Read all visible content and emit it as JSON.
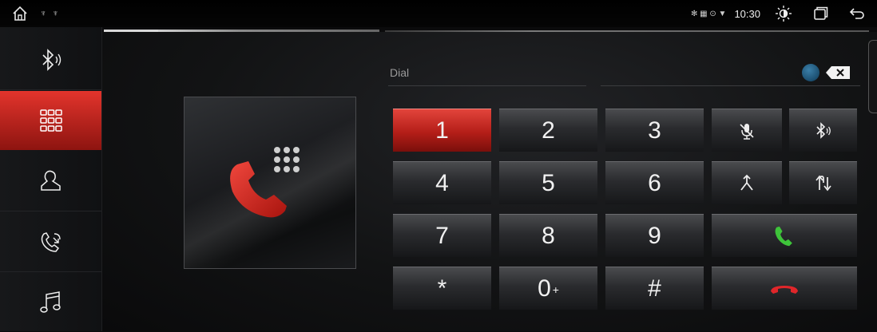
{
  "status_bar": {
    "usb_icons": "♆ ♆",
    "mini_icons": "✻ ▦ ⊙ ▼",
    "time": "10:30"
  },
  "sidebar": {
    "items": [
      {
        "icon": "bluetooth-audio-icon",
        "active": false
      },
      {
        "icon": "dialpad-icon",
        "active": true
      },
      {
        "icon": "contacts-icon",
        "active": false
      },
      {
        "icon": "call-log-icon",
        "active": false
      },
      {
        "icon": "music-note-icon",
        "active": false
      }
    ]
  },
  "dial": {
    "label": "Dial",
    "value": ""
  },
  "keypad": {
    "rows": [
      [
        "1",
        "2",
        "3"
      ],
      [
        "4",
        "5",
        "6"
      ],
      [
        "7",
        "8",
        "9"
      ],
      [
        "*",
        "0",
        "#"
      ]
    ],
    "zero_sub": "+"
  },
  "colors": {
    "accent_red": "#d42a22",
    "call_green": "#3ec43a",
    "hangup_red": "#e0262a"
  }
}
